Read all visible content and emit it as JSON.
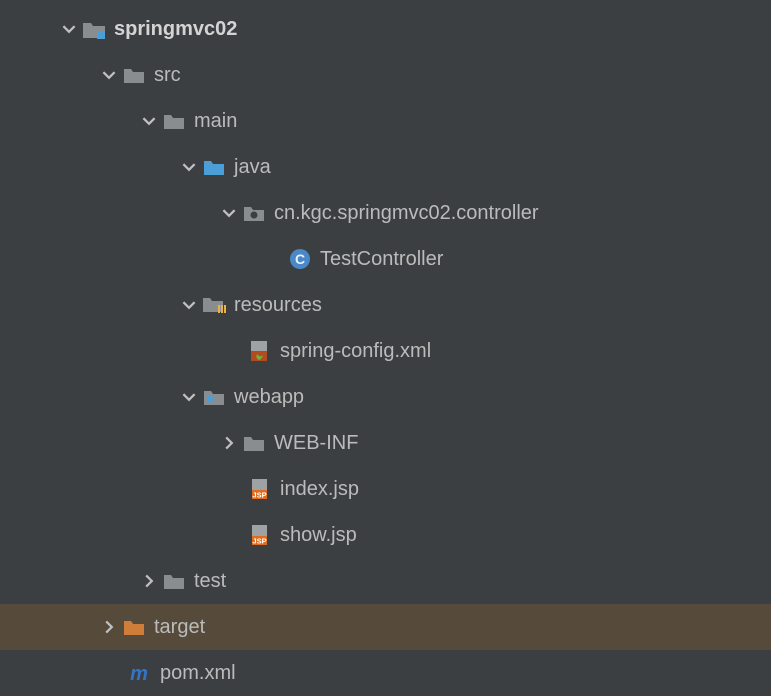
{
  "tree": {
    "root": {
      "name": "springmvc02",
      "children": {
        "src": {
          "name": "src",
          "children": {
            "main": {
              "name": "main",
              "children": {
                "java": {
                  "name": "java",
                  "package": {
                    "name": "cn.kgc.springmvc02.controller",
                    "class": {
                      "name": "TestController"
                    }
                  }
                },
                "resources": {
                  "name": "resources",
                  "file": {
                    "name": "spring-config.xml"
                  }
                },
                "webapp": {
                  "name": "webapp",
                  "webinf": {
                    "name": "WEB-INF"
                  },
                  "index": {
                    "name": "index.jsp"
                  },
                  "show": {
                    "name": "show.jsp"
                  }
                }
              }
            },
            "test": {
              "name": "test"
            }
          }
        },
        "target": {
          "name": "target"
        },
        "pom": {
          "name": "pom.xml"
        }
      }
    }
  },
  "colors": {
    "folderGray": "#8a8d8f",
    "folderBlue": "#4c9ed9",
    "folderOrange": "#d17d3a",
    "classBlue": "#4a88c7",
    "jspOrange": "#e06c1f",
    "jspText": "JSP",
    "mavenBlue": "#3673c4"
  }
}
